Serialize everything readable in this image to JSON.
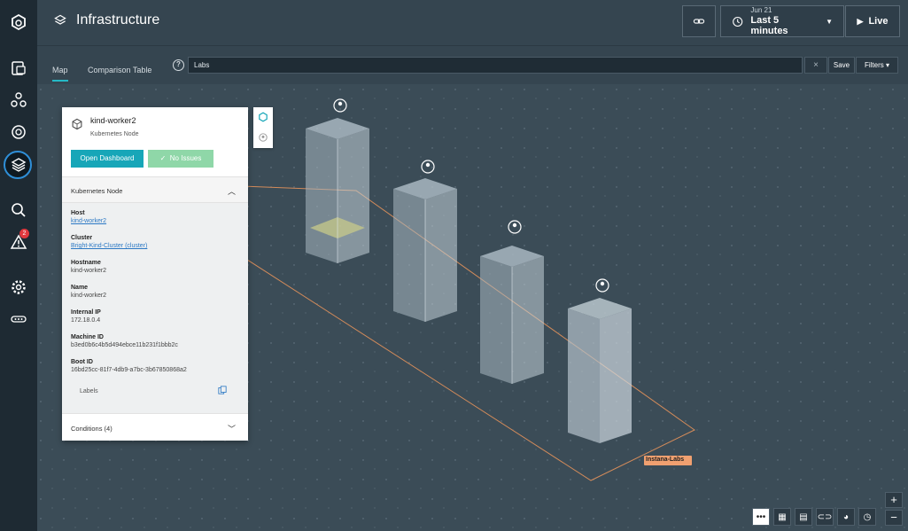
{
  "header": {
    "title": "Infrastructure",
    "time_date": "Jun 21",
    "time_range": "Last 5 minutes",
    "live_label": "Live"
  },
  "subheader": {
    "tabs": [
      {
        "label": "Map",
        "active": true
      },
      {
        "label": "Comparison Table",
        "active": false
      }
    ],
    "search_value": "Labs",
    "clear_label": "×",
    "save_label": "Save",
    "filters_label": "Filters ▾"
  },
  "panel": {
    "node_name": "kind-worker2",
    "node_type": "Kubernetes Node",
    "dashboard_label": "Open Dashboard",
    "issues_label": "No Issues",
    "section_title": "Kubernetes Node",
    "properties": [
      {
        "key": "Host",
        "value": "kind-worker2",
        "link": true
      },
      {
        "key": "Cluster",
        "value": "Bright-Kind-Cluster (cluster)",
        "link": true
      },
      {
        "key": "Hostname",
        "value": "kind-worker2",
        "link": false
      },
      {
        "key": "Name",
        "value": "kind-worker2",
        "link": false
      },
      {
        "key": "Internal IP",
        "value": "172.18.0.4",
        "link": false
      },
      {
        "key": "Machine ID",
        "value": "b3ed0b6c4b5d494ebce11b231f1bbb2c",
        "link": false
      },
      {
        "key": "Boot ID",
        "value": "16bd25cc-81f7-4db9-a7bc-3b67850868a2",
        "link": false
      }
    ],
    "labels_label": "Labels",
    "conditions_label": "Conditions (4)"
  },
  "map": {
    "zone_label": "Instana-Labs",
    "colors": {
      "zone_label_bg": "#f0a070",
      "accent": "#17a6b8",
      "no_issues": "#8fd7a8"
    }
  },
  "nav": {
    "alert_count": "2"
  },
  "zoom": {
    "in_label": "+",
    "out_label": "−"
  }
}
